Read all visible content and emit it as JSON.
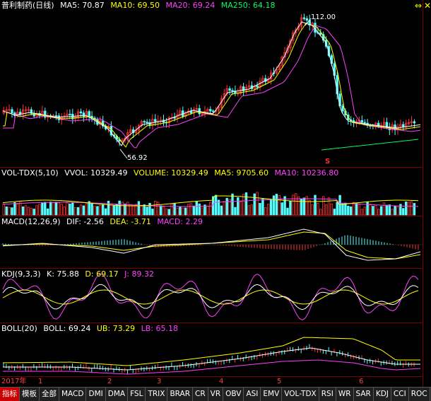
{
  "main": {
    "stock": "普利制药(日线)",
    "ma5": "MA5: 70.87",
    "ma10": "MA10: 69.50",
    "ma20": "MA20: 69.24",
    "ma250": "MA250: 64.18",
    "high_label": "112.00",
    "low_label": "56.92",
    "marker": "S"
  },
  "vol": {
    "name": "VOL-TDX(5,10)",
    "vvol": "VVOL: 10329.49",
    "volume": "VOLUME: 10329.49",
    "ma5": "MA5: 9705.60",
    "ma10": "MA10: 10236.80"
  },
  "macd": {
    "name": "MACD(12,26,9)",
    "dif": "DIF: -2.56",
    "dea": "DEA: -3.71",
    "macd": "MACD: 2.29"
  },
  "kdj": {
    "name": "KDJ(9,3,3)",
    "k": "K: 75.88",
    "d": "D: 69.17",
    "j": "J: 89.32"
  },
  "boll": {
    "name": "BOLL(20)",
    "boll": "BOLL: 69.24",
    "ub": "UB: 73.29",
    "lb": "LB: 65.18"
  },
  "timeline": [
    "2017年",
    "1",
    "2",
    "3",
    "4",
    "5",
    "6"
  ],
  "tabs": [
    "指标",
    "模板",
    "全部",
    "MACD",
    "DMI",
    "DMA",
    "FSL",
    "TRIX",
    "BRAR",
    "CR",
    "VR",
    "OBV",
    "ASI",
    "EMV",
    "VOL-TDX",
    "RSI",
    "WR",
    "SAR",
    "KDJ",
    "CCI",
    "ROC"
  ],
  "nav": [
    "←",
    "→"
  ],
  "colors": {
    "up": "#ff3232",
    "down": "#54ffff",
    "ma5": "#ffffff",
    "ma10": "#ffff00",
    "ma20": "#ff40ff",
    "ma250": "#00ff66"
  }
}
